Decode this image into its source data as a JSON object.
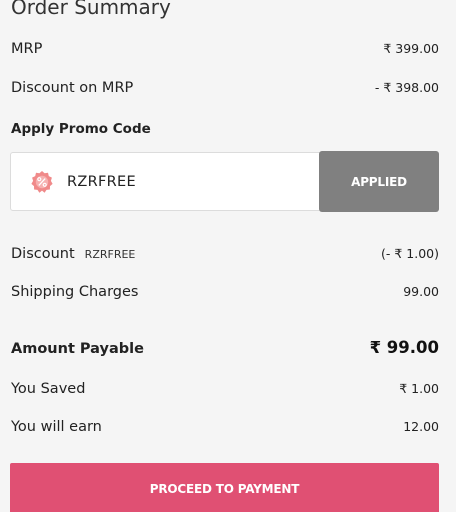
{
  "summary": {
    "title": "Order Summary",
    "mrp_label": "MRP",
    "mrp_value": "₹ 399.00",
    "discount_mrp_label": "Discount on MRP",
    "discount_mrp_value": "- ₹ 398.00"
  },
  "promo": {
    "heading": "Apply Promo Code",
    "icon": "percent-badge-icon",
    "code_value": "RZRFREE",
    "applied_label": "APPLIED",
    "icon_color": "#f08a8a"
  },
  "charges": {
    "discount_label": "Discount",
    "discount_code": "RZRFREE",
    "discount_value": "(- ₹ 1.00)",
    "shipping_label": "Shipping Charges",
    "shipping_value": "99.00",
    "amount_label": "Amount Payable",
    "amount_value": "₹ 99.00",
    "saved_label": "You Saved",
    "saved_value": "₹ 1.00",
    "earn_label": "You will earn",
    "earn_value": "12.00"
  },
  "footer": {
    "pay_label": "PROCEED TO PAYMENT",
    "pay_color": "#e05073"
  }
}
